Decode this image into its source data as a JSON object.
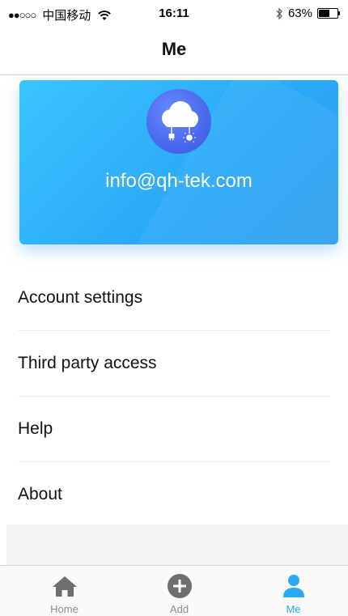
{
  "status_bar": {
    "signal": "●●○○○",
    "carrier": "中国移动",
    "time": "16:11",
    "battery_percent": "63%",
    "battery_level": 0.63,
    "icons": [
      "wifi-icon",
      "bluetooth-icon",
      "battery-icon"
    ]
  },
  "nav": {
    "title": "Me"
  },
  "profile": {
    "email": "info@qh-tek.com",
    "avatar_icon": "cloud-plug-bulb-icon",
    "card_color": "#2aa8f7"
  },
  "menu": {
    "items": [
      {
        "label": "Account settings"
      },
      {
        "label": "Third party access"
      },
      {
        "label": "Help"
      },
      {
        "label": "About"
      }
    ]
  },
  "tabs": {
    "items": [
      {
        "label": "Home",
        "icon": "home-icon",
        "active": false
      },
      {
        "label": "Add",
        "icon": "add-icon",
        "active": false
      },
      {
        "label": "Me",
        "icon": "person-icon",
        "active": true
      }
    ],
    "active_color": "#2aa8f7",
    "inactive_color": "#8c8c8c"
  }
}
